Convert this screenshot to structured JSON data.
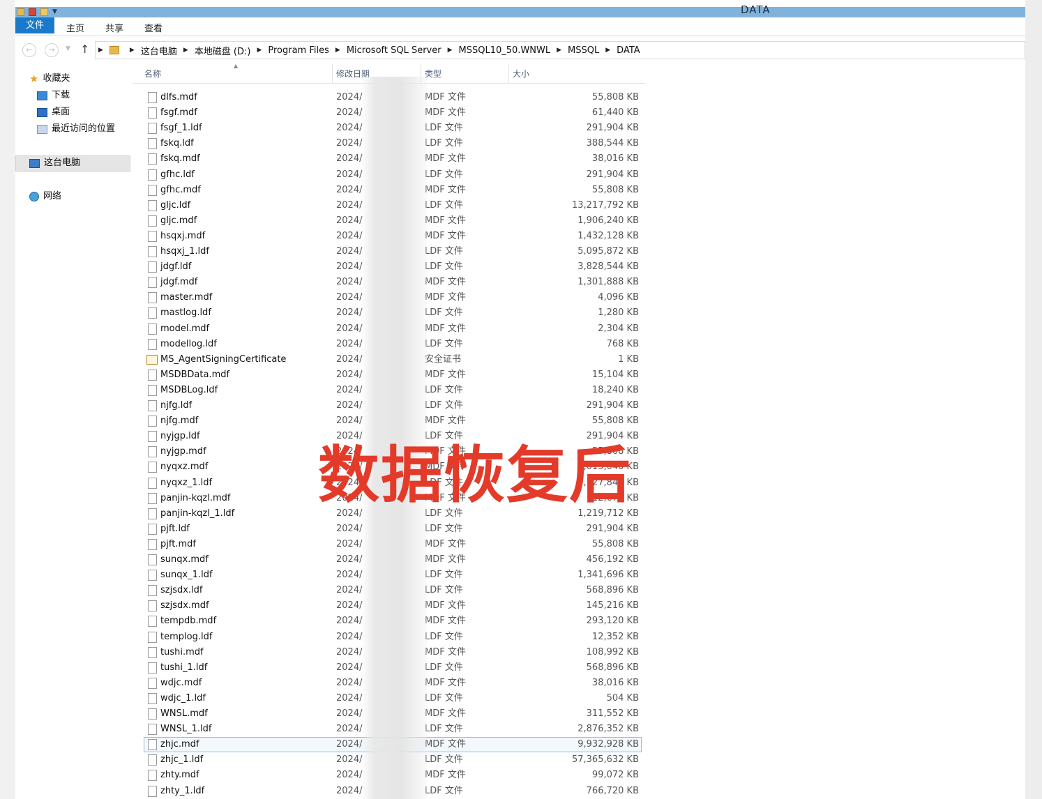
{
  "window": {
    "title": "DATA"
  },
  "ribbon": {
    "tabs": [
      "文件",
      "主页",
      "共享",
      "查看"
    ]
  },
  "address": {
    "breadcrumbs": [
      "这台电脑",
      "本地磁盘 (D:)",
      "Program Files",
      "Microsoft SQL Server",
      "MSSQL10_50.WNWL",
      "MSSQL",
      "DATA"
    ]
  },
  "navpane": {
    "favorites_label": "收藏夹",
    "favorites": [
      "下载",
      "桌面",
      "最近访问的位置"
    ],
    "thispc_label": "这台电脑",
    "network_label": "网络"
  },
  "columns": {
    "name": "名称",
    "date": "修改日期",
    "type": "类型",
    "size": "大小"
  },
  "files": [
    {
      "name": "dlfs.mdf",
      "date": "2024/",
      "type": "MDF 文件",
      "size": "55,808 KB"
    },
    {
      "name": "fsgf.mdf",
      "date": "2024/",
      "type": "MDF 文件",
      "size": "61,440 KB"
    },
    {
      "name": "fsgf_1.ldf",
      "date": "2024/",
      "type": "LDF 文件",
      "size": "291,904 KB"
    },
    {
      "name": "fskq.ldf",
      "date": "2024/",
      "type": "LDF 文件",
      "size": "388,544 KB"
    },
    {
      "name": "fskq.mdf",
      "date": "2024/",
      "type": "MDF 文件",
      "size": "38,016 KB"
    },
    {
      "name": "gfhc.ldf",
      "date": "2024/",
      "type": "LDF 文件",
      "size": "291,904 KB"
    },
    {
      "name": "gfhc.mdf",
      "date": "2024/",
      "type": "MDF 文件",
      "size": "55,808 KB"
    },
    {
      "name": "gljc.ldf",
      "date": "2024/",
      "type": "LDF 文件",
      "size": "13,217,792 KB"
    },
    {
      "name": "gljc.mdf",
      "date": "2024/",
      "type": "MDF 文件",
      "size": "1,906,240 KB"
    },
    {
      "name": "hsqxj.mdf",
      "date": "2024/",
      "type": "MDF 文件",
      "size": "1,432,128 KB"
    },
    {
      "name": "hsqxj_1.ldf",
      "date": "2024/",
      "type": "LDF 文件",
      "size": "5,095,872 KB"
    },
    {
      "name": "jdgf.ldf",
      "date": "2024/",
      "type": "LDF 文件",
      "size": "3,828,544 KB"
    },
    {
      "name": "jdgf.mdf",
      "date": "2024/",
      "type": "MDF 文件",
      "size": "1,301,888 KB"
    },
    {
      "name": "master.mdf",
      "date": "2024/",
      "type": "MDF 文件",
      "size": "4,096 KB"
    },
    {
      "name": "mastlog.ldf",
      "date": "2024/",
      "type": "LDF 文件",
      "size": "1,280 KB"
    },
    {
      "name": "model.mdf",
      "date": "2024/",
      "type": "MDF 文件",
      "size": "2,304 KB"
    },
    {
      "name": "modellog.ldf",
      "date": "2024/",
      "type": "LDF 文件",
      "size": "768 KB"
    },
    {
      "name": "MS_AgentSigningCertificate",
      "date": "2024/",
      "type": "安全证书",
      "size": "1 KB",
      "cert": true
    },
    {
      "name": "MSDBData.mdf",
      "date": "2024/",
      "type": "MDF 文件",
      "size": "15,104 KB"
    },
    {
      "name": "MSDBLog.ldf",
      "date": "2024/",
      "type": "LDF 文件",
      "size": "18,240 KB"
    },
    {
      "name": "njfg.ldf",
      "date": "2024/",
      "type": "LDF 文件",
      "size": "291,904 KB"
    },
    {
      "name": "njfg.mdf",
      "date": "2024/",
      "type": "MDF 文件",
      "size": "55,808 KB"
    },
    {
      "name": "nyjgp.ldf",
      "date": "2024/",
      "type": "LDF 文件",
      "size": "291,904 KB"
    },
    {
      "name": "nyjgp.mdf",
      "date": "2024/",
      "type": "MDF 文件",
      "size": "55,808 KB"
    },
    {
      "name": "nyqxz.mdf",
      "date": "2024/",
      "type": "MDF 文件",
      "size": "5,015,040 KB"
    },
    {
      "name": "nyqxz_1.ldf",
      "date": "2024/",
      "type": "LDF 文件",
      "size": "9,727,840 KB"
    },
    {
      "name": "panjin-kqzl.mdf",
      "date": "2024/",
      "type": "MDF 文件",
      "size": "12,672 KB"
    },
    {
      "name": "panjin-kqzl_1.ldf",
      "date": "2024/",
      "type": "LDF 文件",
      "size": "1,219,712 KB"
    },
    {
      "name": "pjft.ldf",
      "date": "2024/",
      "type": "LDF 文件",
      "size": "291,904 KB"
    },
    {
      "name": "pjft.mdf",
      "date": "2024/",
      "type": "MDF 文件",
      "size": "55,808 KB"
    },
    {
      "name": "sunqx.mdf",
      "date": "2024/",
      "type": "MDF 文件",
      "size": "456,192 KB"
    },
    {
      "name": "sunqx_1.ldf",
      "date": "2024/",
      "type": "LDF 文件",
      "size": "1,341,696 KB"
    },
    {
      "name": "szjsdx.ldf",
      "date": "2024/",
      "type": "LDF 文件",
      "size": "568,896 KB"
    },
    {
      "name": "szjsdx.mdf",
      "date": "2024/",
      "type": "MDF 文件",
      "size": "145,216 KB"
    },
    {
      "name": "tempdb.mdf",
      "date": "2024/",
      "type": "MDF 文件",
      "size": "293,120 KB"
    },
    {
      "name": "templog.ldf",
      "date": "2024/",
      "type": "LDF 文件",
      "size": "12,352 KB"
    },
    {
      "name": "tushi.mdf",
      "date": "2024/",
      "type": "MDF 文件",
      "size": "108,992 KB"
    },
    {
      "name": "tushi_1.ldf",
      "date": "2024/",
      "type": "LDF 文件",
      "size": "568,896 KB"
    },
    {
      "name": "wdjc.mdf",
      "date": "2024/",
      "type": "MDF 文件",
      "size": "38,016 KB"
    },
    {
      "name": "wdjc_1.ldf",
      "date": "2024/",
      "type": "LDF 文件",
      "size": "504 KB"
    },
    {
      "name": "WNSL.mdf",
      "date": "2024/",
      "type": "MDF 文件",
      "size": "311,552 KB"
    },
    {
      "name": "WNSL_1.ldf",
      "date": "2024/",
      "type": "LDF 文件",
      "size": "2,876,352 KB"
    },
    {
      "name": "zhjc.mdf",
      "date": "2024/",
      "type": "MDF 文件",
      "size": "9,932,928 KB",
      "selected": true
    },
    {
      "name": "zhjc_1.ldf",
      "date": "2024/",
      "type": "LDF 文件",
      "size": "57,365,632 KB"
    },
    {
      "name": "zhty.mdf",
      "date": "2024/",
      "type": "MDF 文件",
      "size": "99,072 KB"
    },
    {
      "name": "zhty_1.ldf",
      "date": "2024/",
      "type": "LDF 文件",
      "size": "766,720 KB"
    }
  ],
  "overlay_text": "数据恢复后"
}
